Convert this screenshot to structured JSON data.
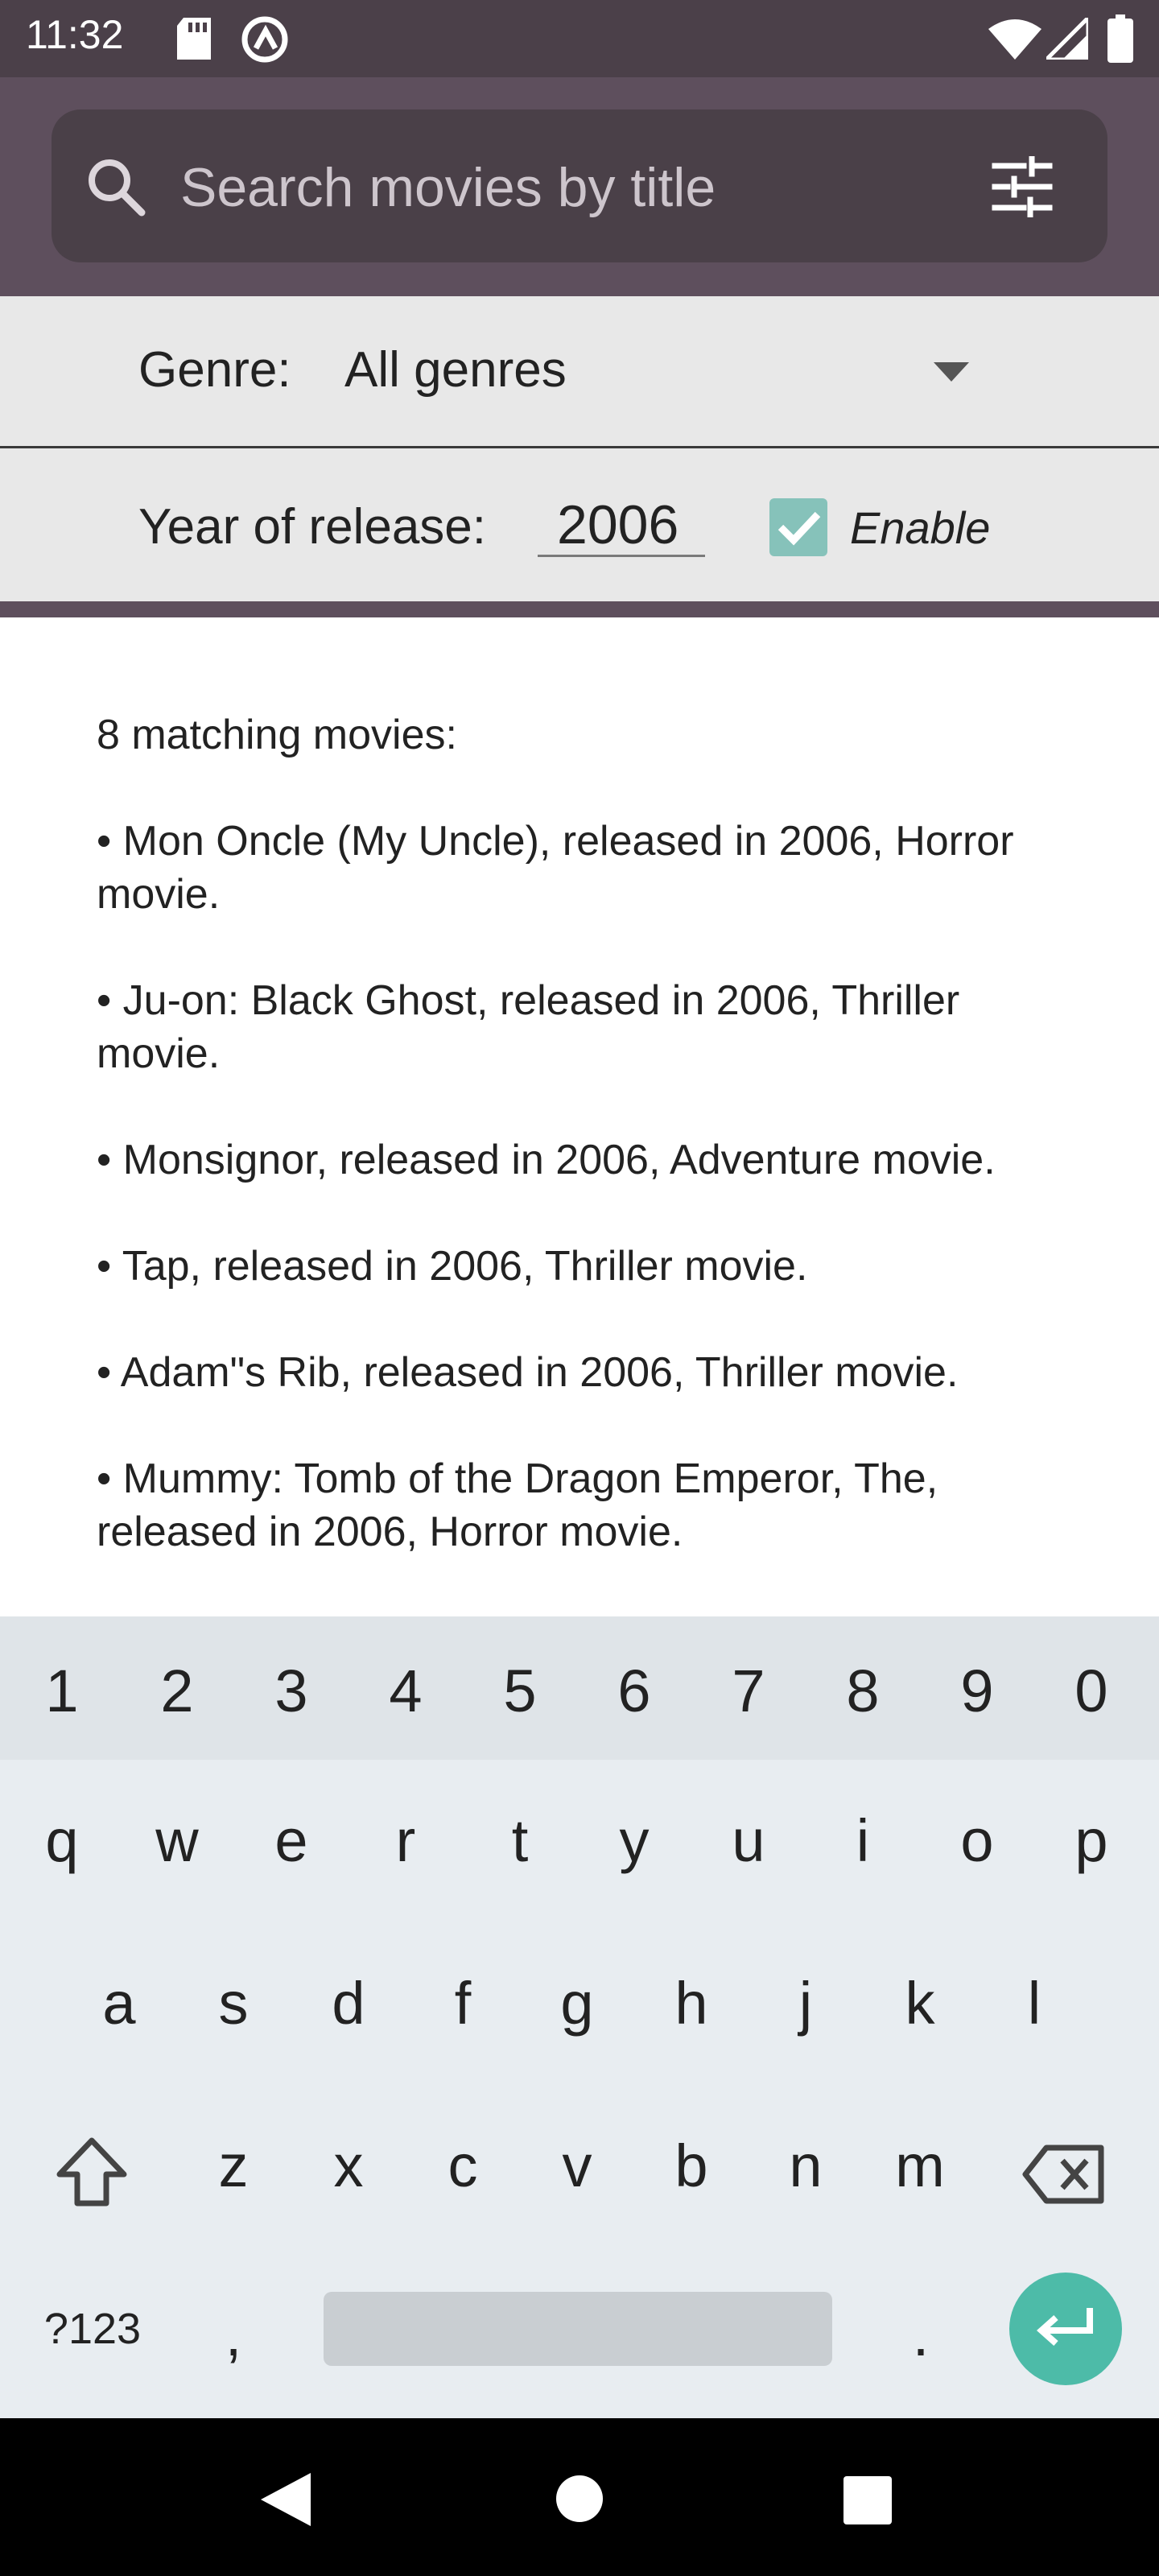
{
  "status_bar": {
    "time": "11:32"
  },
  "search": {
    "placeholder": "Search movies by title"
  },
  "filters": {
    "genre_label": "Genre:",
    "genre_value": "All genres",
    "year_label": "Year of release:",
    "year_value": "2006",
    "enable_label": "Enable",
    "enable_checked": true
  },
  "results": {
    "summary": "8 matching movies:",
    "items": [
      "• Mon Oncle (My Uncle), released in 2006, Horror movie.",
      "• Ju-on: Black Ghost, released in 2006, Thriller movie.",
      "• Monsignor, released in 2006, Adventure movie.",
      "• Tap, released in 2006, Thriller movie.",
      "• Adam\"s Rib, released in 2006, Thriller movie.",
      "• Mummy: Tomb of the Dragon Emperor, The, released in 2006, Horror movie."
    ]
  },
  "keyboard": {
    "row_numbers": [
      "1",
      "2",
      "3",
      "4",
      "5",
      "6",
      "7",
      "8",
      "9",
      "0"
    ],
    "row1": [
      "q",
      "w",
      "e",
      "r",
      "t",
      "y",
      "u",
      "i",
      "o",
      "p"
    ],
    "row2": [
      "a",
      "s",
      "d",
      "f",
      "g",
      "h",
      "j",
      "k",
      "l"
    ],
    "row3": [
      "z",
      "x",
      "c",
      "v",
      "b",
      "n",
      "m"
    ],
    "symbols_key": "?123",
    "comma_key": ",",
    "period_key": "."
  },
  "colors": {
    "app_bar": "#5e4f5d",
    "search_bg": "#4a4048",
    "checkbox": "#86c2ba",
    "enter_key": "#4dbba8"
  }
}
